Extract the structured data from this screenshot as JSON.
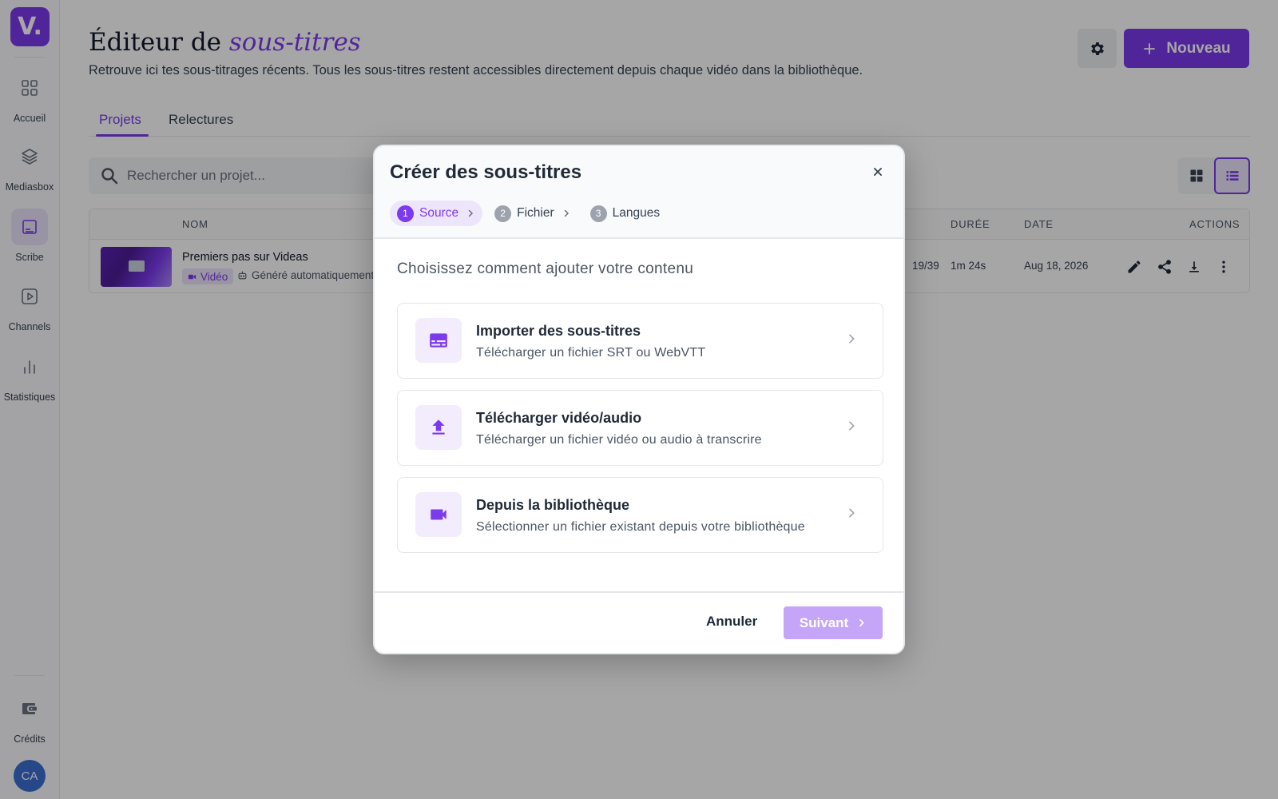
{
  "app": {
    "logo_text": "V.",
    "brand_color": "#7c3aed",
    "user_initials": "CA"
  },
  "sidebar": {
    "items": [
      {
        "label": "Accueil",
        "icon": "grid-icon",
        "active": false
      },
      {
        "label": "Mediasbox",
        "icon": "layers-icon",
        "active": false
      },
      {
        "label": "Scribe",
        "icon": "subtitles-icon",
        "active": true
      },
      {
        "label": "Channels",
        "icon": "play-icon",
        "active": false
      },
      {
        "label": "Statistiques",
        "icon": "bar-chart-icon",
        "active": false
      }
    ],
    "bottom": {
      "label": "Crédits",
      "icon": "wallet-icon"
    }
  },
  "header": {
    "title_prefix": "Éditeur de ",
    "title_accent": "sous-titres",
    "subtitle": "Retrouve ici tes sous-titrages récents. Tous les sous-titres restent accessibles directement depuis chaque vidéo dans la bibliothèque.",
    "new_button": "Nouveau"
  },
  "tabs": [
    {
      "label": "Projets",
      "active": true
    },
    {
      "label": "Relectures",
      "active": false
    }
  ],
  "search": {
    "placeholder": "Rechercher un projet..."
  },
  "table": {
    "columns": {
      "name": "NOM",
      "duration": "DURÉE",
      "date": "DATE",
      "actions": "ACTIONS"
    },
    "rows": [
      {
        "name": "Premiers pas sur Videas",
        "badge": "Vidéo",
        "auto": "Généré automatiquement",
        "progress": "19/39",
        "duration": "1m 24s",
        "date": "Aug 18, 2026"
      }
    ]
  },
  "modal": {
    "title": "Créer des sous-titres",
    "steps": [
      {
        "num": "1",
        "label": "Source",
        "active": true
      },
      {
        "num": "2",
        "label": "Fichier",
        "active": false
      },
      {
        "num": "3",
        "label": "Langues",
        "active": false
      }
    ],
    "prompt": "Choisissez comment ajouter votre contenu",
    "options": [
      {
        "title": "Importer des sous-titres",
        "desc": "Télécharger un fichier SRT ou WebVTT",
        "icon": "subtitles-icon"
      },
      {
        "title": "Télécharger vidéo/audio",
        "desc": "Télécharger un fichier vidéo ou audio à transcrire",
        "icon": "upload-icon"
      },
      {
        "title": "Depuis la bibliothèque",
        "desc": "Sélectionner un fichier existant depuis votre bibliothèque",
        "icon": "video-camera-icon"
      }
    ],
    "cancel": "Annuler",
    "next": "Suivant"
  }
}
